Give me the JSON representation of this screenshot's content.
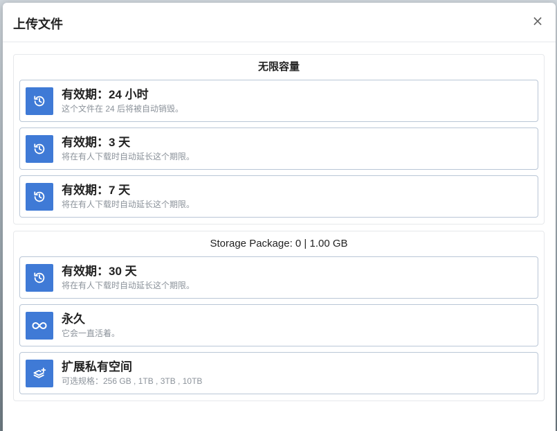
{
  "modal": {
    "title": "上传文件",
    "close_label": "×"
  },
  "sections": [
    {
      "title": "无限容量",
      "options": [
        {
          "icon": "history-icon",
          "title": "有效期：24 小时",
          "desc": "这个文件在 24 后将被自动销毁。"
        },
        {
          "icon": "history-icon",
          "title": "有效期：3 天",
          "desc": "将在有人下载时自动延长这个期限。"
        },
        {
          "icon": "history-icon",
          "title": "有效期：7 天",
          "desc": "将在有人下载时自动延长这个期限。"
        }
      ]
    },
    {
      "title": "Storage Package: 0 | 1.00 GB",
      "options": [
        {
          "icon": "history-icon",
          "title": "有效期：30 天",
          "desc": "将在有人下载时自动延长这个期限。"
        },
        {
          "icon": "infinity-icon",
          "title": "永久",
          "desc": "它会一直活着。"
        },
        {
          "icon": "layers-plus-icon",
          "title": "扩展私有空间",
          "desc": "可选规格：256 GB , 1TB , 3TB , 10TB"
        }
      ]
    }
  ],
  "colors": {
    "accent": "#3f7ad6",
    "option_border": "#b9c6d6"
  }
}
